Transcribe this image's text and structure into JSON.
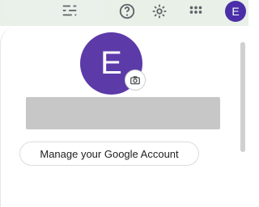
{
  "topbar": {
    "icons": [
      "tune-icon",
      "help-icon",
      "settings-icon",
      "apps-icon"
    ],
    "account_initial": "E"
  },
  "account": {
    "avatar_initial": "E",
    "camera_icon": "camera-icon",
    "manage_label": "Manage your Google Account"
  },
  "colors": {
    "avatar": "#5c3aa8",
    "topbar_bg": "#e8f0e8"
  }
}
